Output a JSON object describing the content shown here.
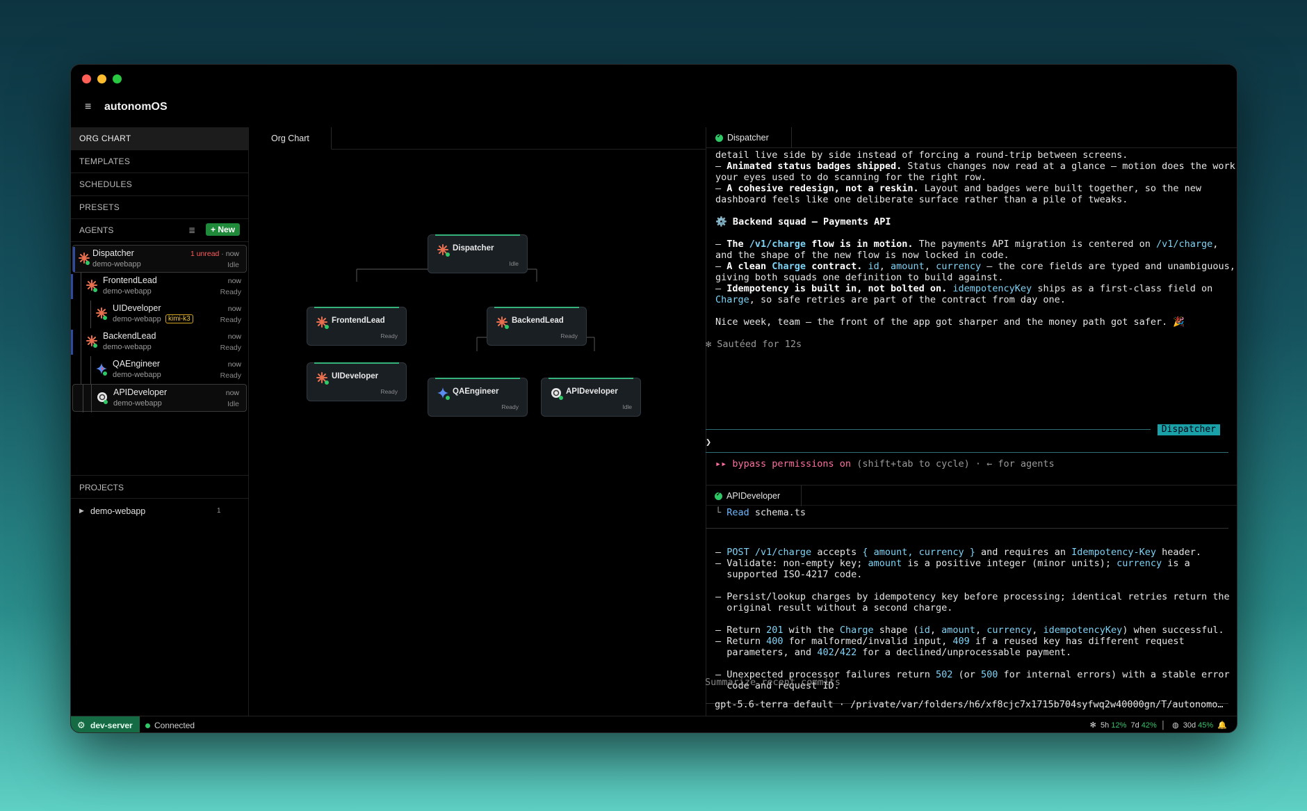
{
  "app": {
    "title": "autonomOS"
  },
  "nav": {
    "items": [
      "ORG CHART",
      "TEMPLATES",
      "SCHEDULES",
      "PRESETS"
    ],
    "agents_label": "AGENTS",
    "new_label": "+ New",
    "projects_label": "PROJECTS"
  },
  "agents": [
    {
      "name": "Dispatcher",
      "project": "demo-webapp",
      "unread": "1 unread",
      "when": "now",
      "state": "Idle"
    },
    {
      "name": "FrontendLead",
      "project": "demo-webapp",
      "when": "now",
      "state": "Ready"
    },
    {
      "name": "UIDeveloper",
      "project": "demo-webapp",
      "badge": "kimi-k3",
      "when": "now",
      "state": "Ready"
    },
    {
      "name": "BackendLead",
      "project": "demo-webapp",
      "when": "now",
      "state": "Ready"
    },
    {
      "name": "QAEngineer",
      "project": "demo-webapp",
      "when": "now",
      "state": "Ready"
    },
    {
      "name": "APIDeveloper",
      "project": "demo-webapp",
      "when": "now",
      "state": "Idle"
    }
  ],
  "projects": [
    {
      "name": "demo-webapp",
      "count": "1"
    }
  ],
  "org": {
    "tab": "Org Chart",
    "nodes": [
      {
        "name": "Dispatcher",
        "state": "Idle"
      },
      {
        "name": "FrontendLead",
        "state": "Ready"
      },
      {
        "name": "BackendLead",
        "state": "Ready"
      },
      {
        "name": "UIDeveloper",
        "state": "Ready"
      },
      {
        "name": "QAEngineer",
        "state": "Ready"
      },
      {
        "name": "APIDeveloper",
        "state": "Idle"
      }
    ]
  },
  "dispatcher_pane": {
    "tab": "Dispatcher",
    "l1": "detail live side by side instead of forcing a round-trip between screens.",
    "l2a": "– ",
    "l2b": "Animated status badges shipped.",
    "l2c": " Status changes now read at a glance — motion does the work",
    "l3": "your eyes used to do scanning for the right row.",
    "l4a": "– ",
    "l4b": "A cohesive redesign, not a reskin.",
    "l4c": " Layout and badges were built together, so the new",
    "l5": "dashboard feels like one deliberate surface rather than a pile of tweaks.",
    "h1": "⚙️ Backend squad — Payments API",
    "p1a": "– ",
    "p1b": "The ",
    "p1c": "/v1/charge",
    "p1d": " flow is in motion.",
    "p1e": " The payments API migration is centered on ",
    "p1f": "/v1/charge",
    "p1g": ",",
    "p2": "and the shape of the new flow is now locked in code.",
    "p3a": "– ",
    "p3b": "A clean ",
    "p3c": "Charge",
    "p3d": " contract.",
    "p3e": " ",
    "p3f": "id",
    "p3g": ", ",
    "p3h": "amount",
    "p3i": ", ",
    "p3j": "currency",
    "p3k": " — the core fields are typed and unambiguous,",
    "p4": "giving both squads one definition to build against.",
    "p5a": "– ",
    "p5b": "Idempotency is built in, not bolted on.",
    "p5c": " ",
    "p5d": "idempotencyKey",
    "p5e": " ships as a first-class field on",
    "p6a": "Charge",
    "p6b": ", so safe retries are part of the contract from day one.",
    "closing": "Nice week, team — the front of the app got sharper and the money path got safer. 🎉",
    "sauteed": "✻ Sautéed for 12s",
    "badge": "Dispatcher",
    "prompt": "❯",
    "bypass_a": "▸▸ bypass permissions on",
    "bypass_b": " (shift+tab to cycle) · ← for agents"
  },
  "api_pane": {
    "tab": "APIDeveloper",
    "read_a": "└ ",
    "read_b": "Read",
    "read_c": " schema.ts",
    "r1a": "– ",
    "r1b": "POST /v1/charge",
    "r1c": " accepts ",
    "r1d": "{ amount, currency }",
    "r1e": " and requires an ",
    "r1f": "Idempotency-Key",
    "r1g": " header.",
    "r2a": "– Validate: non-empty key; ",
    "r2b": "amount",
    "r2c": " is a positive integer (minor units); ",
    "r2d": "currency",
    "r2e": " is a",
    "r3": "  supported ISO-4217 code.",
    "r4": "– Persist/lookup charges by idempotency key before processing; identical retries return the",
    "r5": "  original result without a second charge.",
    "r6a": "– Return ",
    "r6b": "201",
    "r6c": " with the ",
    "r6d": "Charge",
    "r6e": " shape (",
    "r6f": "id",
    "r6g": ", ",
    "r6h": "amount",
    "r6i": ", ",
    "r6j": "currency",
    "r6k": ", ",
    "r6l": "idempotencyKey",
    "r6m": ") when successful.",
    "r7a": "– Return ",
    "r7b": "400",
    "r7c": " for malformed/invalid input, ",
    "r7d": "409",
    "r7e": " if a reused key has different request",
    "r8a": "  parameters, and ",
    "r8b": "402",
    "r8c": "/",
    "r8d": "422",
    "r8e": " for a declined/unprocessable payment.",
    "r9a": "– Unexpected processor failures return ",
    "r9b": "502",
    "r9c": " (or ",
    "r9d": "500",
    "r9e": " for internal errors) with a stable error",
    "r10": "  code and request ID.",
    "input_placeholder": "Summarize recent commits",
    "model_line": "gpt-5.6-terra default  ·  /private/var/folders/h6/xf8cjc7x1715b704syfwq2w40000gn/T/autonomos-…"
  },
  "status": {
    "server": "dev-server",
    "connection": "Connected",
    "u1": "5h",
    "u1p": "12%",
    "u2": "7d",
    "u2p": "42%",
    "u3": "30d",
    "u3p": "45%"
  }
}
